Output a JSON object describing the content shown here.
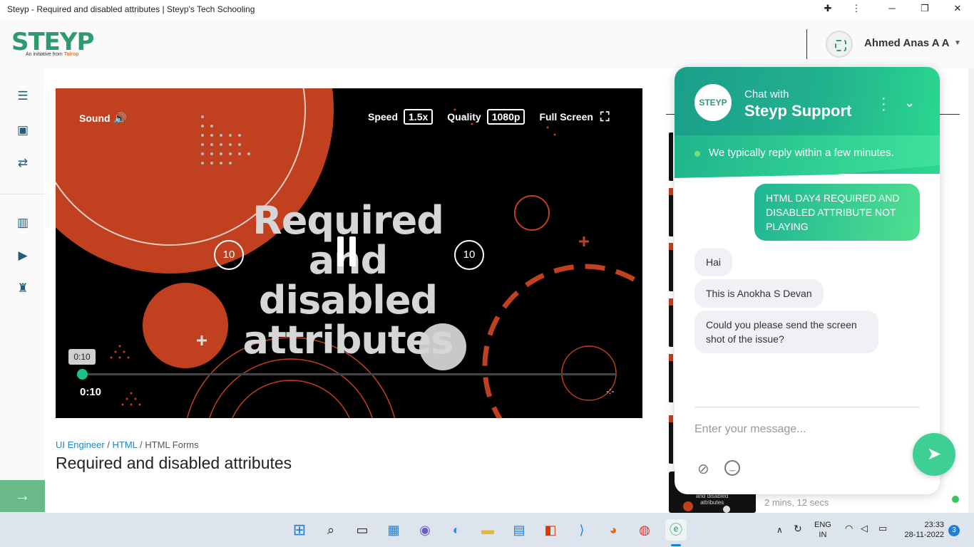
{
  "window": {
    "title": "Steyp - Required and disabled attributes | Steyp's Tech Schooling",
    "controls": {
      "extension": "puzzle-icon",
      "menu": "⋮",
      "minimize": "─",
      "maximize": "❐",
      "close": "✕"
    }
  },
  "header": {
    "logo": "STEYP",
    "logo_sub_prefix": "An initiative from ",
    "logo_sub_brand": "Talrop",
    "user_name": "Ahmed Anas A A"
  },
  "sidebar": {
    "items": [
      {
        "icon": "sliders-icon"
      },
      {
        "icon": "calendar-icon"
      },
      {
        "icon": "route-icon"
      },
      {
        "icon": "leaderboard-icon"
      },
      {
        "icon": "video-icon"
      },
      {
        "icon": "trophy-icon"
      }
    ],
    "next_icon": "arrow-right-icon"
  },
  "video": {
    "sound_label": "Sound",
    "speed_label": "Speed",
    "speed_value": "1.5x",
    "quality_label": "Quality",
    "quality_value": "1080p",
    "fullscreen_label": "Full Screen",
    "title_lines": [
      "Required",
      "and disabled",
      "attributes"
    ],
    "rewind_label": "10",
    "forward_label": "10",
    "tooltip_time": "0:10",
    "current_time": "0:10",
    "end_time": "-:-",
    "progress": 0.0
  },
  "breadcrumb": {
    "items": [
      "UI Engineer",
      "HTML"
    ],
    "current": "HTML Forms",
    "separator": " / "
  },
  "page_title": "Required and disabled attributes",
  "playlist": {
    "thumb_text": [
      "and disabled",
      "attributes"
    ],
    "duration": "2 mins, 12 secs"
  },
  "chat": {
    "logo": "STEYP",
    "chat_with": "Chat with",
    "support_name": "Steyp Support",
    "reply_status": "We typically reply within a few minutes.",
    "messages_out": [
      "HTML DAY4 REQUIRED AND DISABLED ATTRIBUTE NOT PLAYING"
    ],
    "messages_in": [
      "Hai",
      "This is Anokha S Devan",
      "Could you please send the screen shot of the issue?"
    ],
    "input_placeholder": "Enter your message..."
  },
  "taskbar": {
    "lang": "ENG",
    "region": "IN",
    "time": "23:33",
    "date": "28-11-2022",
    "notifications": "3"
  },
  "colors": {
    "brand": "#2e9b6e",
    "video_accent": "#c0401f",
    "chat_gradient_start": "#1a9e8a",
    "chat_gradient_end": "#3fe39a",
    "link": "#1e88c8"
  }
}
